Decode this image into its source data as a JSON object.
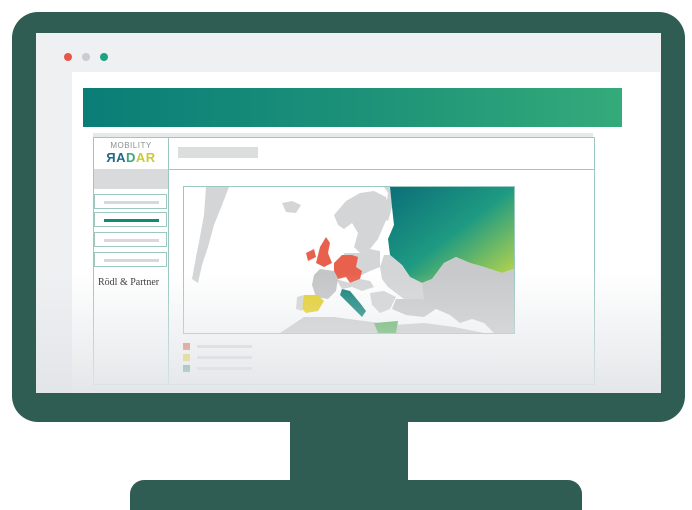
{
  "window": {
    "controls": [
      {
        "name": "close",
        "color": "#e8564a"
      },
      {
        "name": "minimize",
        "color": "#c9ccd0"
      },
      {
        "name": "maximize",
        "color": "#1aa384"
      }
    ]
  },
  "banner": {
    "colors": [
      "#0a7d77",
      "#34ab7a"
    ]
  },
  "app": {
    "logo": {
      "top": "MOBILITY",
      "bottom_parts": [
        "ЯA",
        "D",
        "AR"
      ]
    },
    "sidebar": {
      "items": [
        {
          "name": "nav-item-1",
          "active": false
        },
        {
          "name": "nav-item-2",
          "active": true
        },
        {
          "name": "nav-item-3",
          "active": false
        },
        {
          "name": "nav-item-4",
          "active": false
        }
      ],
      "brand": "Rödl & Partner"
    },
    "map": {
      "highlight_colors": {
        "red": "#e8614d",
        "yellow": "#e6cf22",
        "teal": "#0d7f77",
        "green": "#59b15c"
      },
      "legend": [
        {
          "color": "#e8614d"
        },
        {
          "color": "#e6cf22"
        },
        {
          "color": "#0d7f77"
        }
      ]
    }
  }
}
